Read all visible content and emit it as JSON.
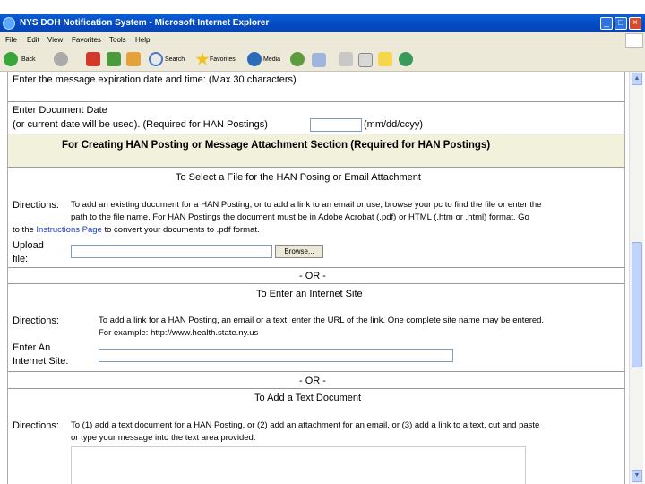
{
  "window": {
    "title": "NYS DOH Notification System - Microsoft Internet Explorer",
    "minimize_glyph": "_",
    "maximize_glyph": "□",
    "close_glyph": "×"
  },
  "menu": [
    "File",
    "Edit",
    "View",
    "Favorites",
    "Tools",
    "Help"
  ],
  "toolbar": {
    "back": "Back",
    "search": "Search",
    "favorites": "Favorites",
    "media": "Media"
  },
  "form": {
    "expiration_label": "Enter the message expiration date and time: (Max 30 characters)",
    "doc_date_label_1": "Enter Document Date",
    "doc_date_label_2": "(or current date will be used). (Required for HAN Postings)",
    "doc_date_format": "(mm/dd/ccyy)",
    "section_header": "For Creating HAN Posting or Message Attachment Section (Required for HAN Postings)",
    "file_title": "To Select a File for the HAN Posing or Email Attachment",
    "directions_label": "Directions:",
    "file_dir_1": "To add an existing document for a HAN Posting, or to add a link to an email or use, browse your pc to find the file or enter the",
    "file_dir_2": "path to the file name. For HAN Postings the document must be in Adobe Acrobat (.pdf) or HTML (.htm or .html) format. Go",
    "file_dir_3_a": "to the ",
    "file_dir_3_link": "Instructions Page",
    "file_dir_3_b": " to convert your documents to .pdf format.",
    "upload_label_1": "Upload",
    "upload_label_2": "file:",
    "browse_button": "Browse...",
    "or_1": "- OR -",
    "internet_title": "To Enter an Internet Site",
    "internet_dir_1": "To add a link for a HAN Posting, an email or a text, enter the URL of the link. One complete site name may be entered.",
    "internet_dir_2": "For example: http://www.health.state.ny.us",
    "internet_label_1": "Enter An",
    "internet_label_2": "Internet Site:",
    "or_2": "- OR -",
    "text_title": "To Add a Text Document",
    "text_dir_1": "To (1) add a text document for a HAN Posting, or (2) add an attachment for an email, or (3) add a link to a text, cut and paste",
    "text_dir_2": "or type your message into the text area provided."
  },
  "scrollbar": {
    "up_glyph": "▲",
    "down_glyph": "▼"
  }
}
